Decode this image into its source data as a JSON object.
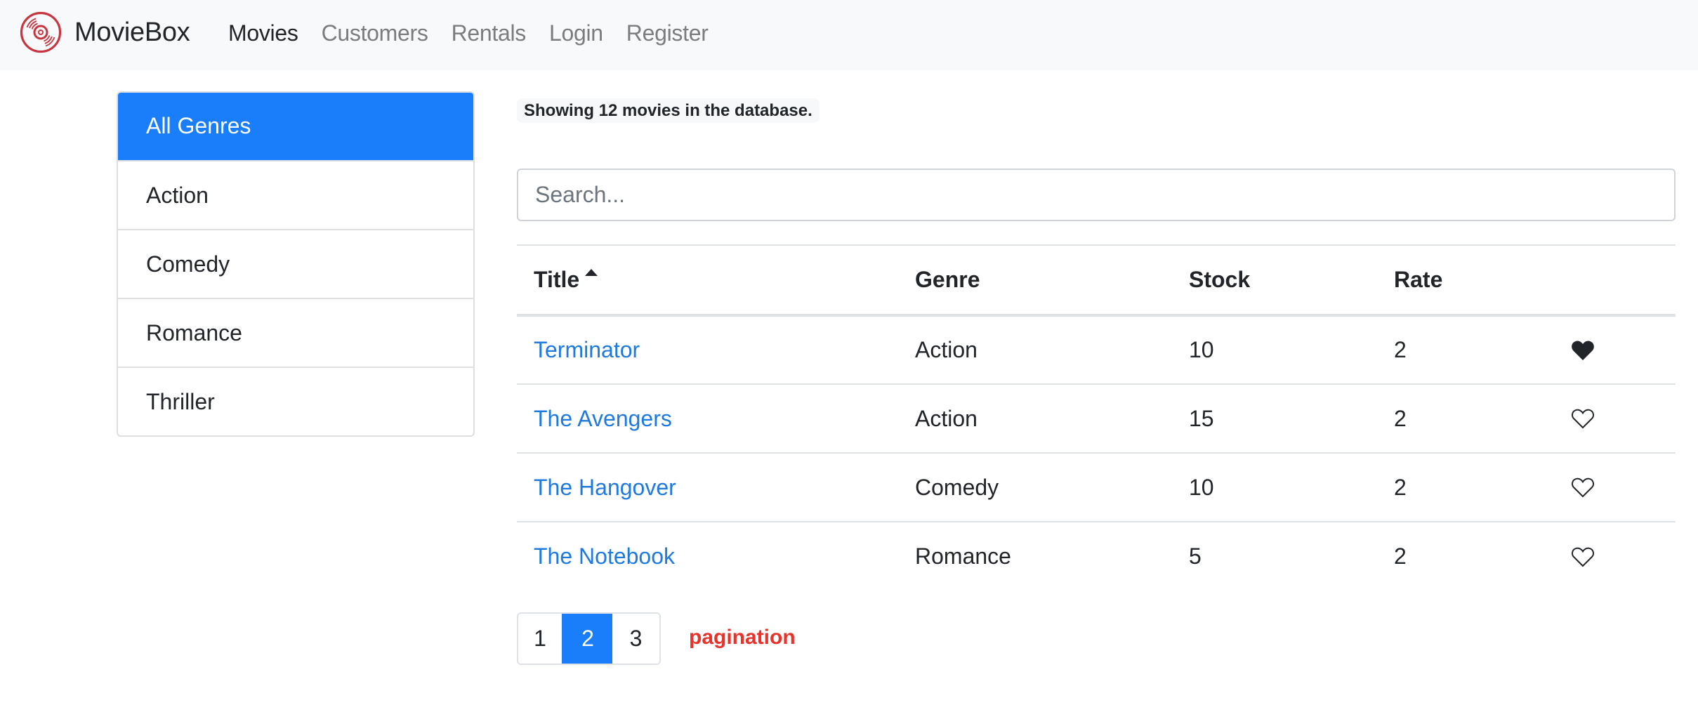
{
  "navbar": {
    "brand": "MovieBox",
    "brand_icon": "vinyl-disc-icon",
    "brand_color": "#c9353f",
    "links": [
      {
        "label": "Movies",
        "active": true
      },
      {
        "label": "Customers",
        "active": false
      },
      {
        "label": "Rentals",
        "active": false
      },
      {
        "label": "Login",
        "active": false
      },
      {
        "label": "Register",
        "active": false
      }
    ]
  },
  "sidebar": {
    "items": [
      {
        "label": "All Genres",
        "active": true
      },
      {
        "label": "Action",
        "active": false
      },
      {
        "label": "Comedy",
        "active": false
      },
      {
        "label": "Romance",
        "active": false
      },
      {
        "label": "Thriller",
        "active": false
      }
    ],
    "active_color": "#1a7efb"
  },
  "main": {
    "count_text": "Showing 12 movies in the database.",
    "search": {
      "placeholder": "Search...",
      "value": ""
    },
    "table": {
      "columns": [
        {
          "label": "Title",
          "sort": "ascending",
          "sort_icon": "caret-up-icon"
        },
        {
          "label": "Genre"
        },
        {
          "label": "Stock"
        },
        {
          "label": "Rate"
        },
        {
          "label": ""
        }
      ],
      "rows": [
        {
          "title": "Terminator",
          "genre": "Action",
          "stock": "10",
          "rate": "2",
          "liked": true
        },
        {
          "title": "The Avengers",
          "genre": "Action",
          "stock": "15",
          "rate": "2",
          "liked": false
        },
        {
          "title": "The Hangover",
          "genre": "Comedy",
          "stock": "10",
          "rate": "2",
          "liked": false
        },
        {
          "title": "The Notebook",
          "genre": "Romance",
          "stock": "5",
          "rate": "2",
          "liked": false
        }
      ],
      "link_color": "#1f7ae0"
    },
    "pagination": {
      "pages": [
        "1",
        "2",
        "3"
      ],
      "current": "2",
      "label": "pagination",
      "label_color": "#e8322a"
    }
  }
}
